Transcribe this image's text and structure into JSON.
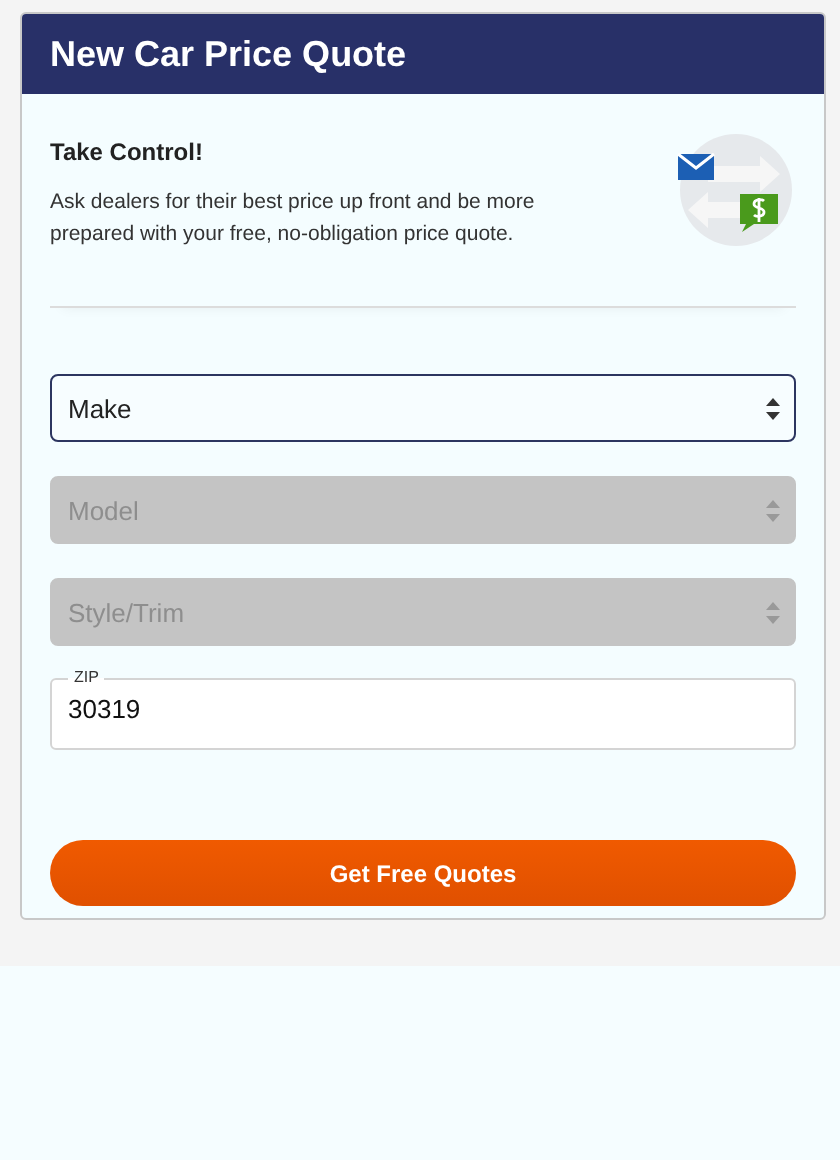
{
  "card": {
    "title": "New Car Price Quote"
  },
  "intro": {
    "heading": "Take Control!",
    "text": "Ask dealers for their best price up front and be more prepared with your free, no-obligation price quote."
  },
  "selects": [
    {
      "label": "Make",
      "disabled": false
    },
    {
      "label": "Model",
      "disabled": true
    },
    {
      "label": "Style/Trim",
      "disabled": true
    }
  ],
  "zip": {
    "label": "ZIP",
    "value": "30319"
  },
  "submit": {
    "label": "Get Free Quotes"
  }
}
